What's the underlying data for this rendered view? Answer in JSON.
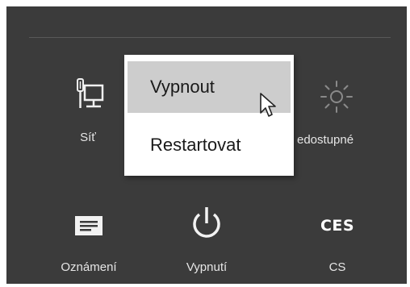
{
  "tiles": {
    "network": {
      "label": "Síť",
      "icon": "network-icon"
    },
    "brightness": {
      "label": "edostupné",
      "icon": "brightness-icon"
    },
    "notifications": {
      "label": "Oznámení",
      "icon": "notifications-icon"
    },
    "power": {
      "label": "Vypnutí",
      "icon": "power-icon"
    },
    "keyboard": {
      "label": "CS",
      "icon_text": "CES"
    }
  },
  "power_menu": {
    "items": [
      {
        "label": "Vypnout",
        "highlighted": true
      },
      {
        "label": "Restartovat",
        "highlighted": false
      }
    ]
  },
  "colors": {
    "panel_background": "#3b3b3b",
    "menu_background": "#ffffff",
    "menu_highlight": "#cdcdcd"
  }
}
